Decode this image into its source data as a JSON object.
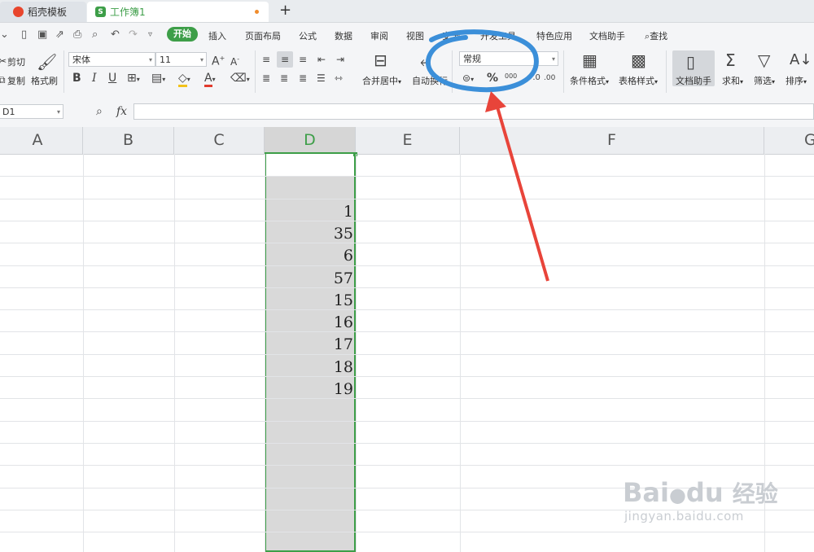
{
  "tabs": [
    {
      "label": "稻壳模板",
      "icon": "docer-logo-icon"
    },
    {
      "label": "工作簿1",
      "icon": "sheet-logo-icon",
      "icon_text": "S"
    }
  ],
  "new_tab_label": "+",
  "menu": {
    "start": "开始",
    "items": [
      "插入",
      "页面布局",
      "公式",
      "数据",
      "审阅",
      "视图",
      "安全",
      "开发工具",
      "特色应用",
      "文档助手"
    ],
    "search": "查找"
  },
  "ribbon": {
    "cut": "剪切",
    "copy": "复制",
    "format_painter": "格式刷",
    "font_name": "宋体",
    "font_size": "11",
    "bold": "B",
    "italic": "I",
    "underline": "U",
    "merge_center": "合并居中",
    "wrap_text": "自动换行",
    "number_format": "常规",
    "percent": "%",
    "thousands": "000",
    "decimal_dec": ".00",
    "conditional_format": "条件格式",
    "table_style": "表格样式",
    "doc_assistant": "文档助手",
    "sum": "求和",
    "filter": "筛选",
    "sort": "排序"
  },
  "formula_bar": {
    "name_box": "D1",
    "fx": "fx",
    "value": ""
  },
  "columns": [
    "A",
    "B",
    "C",
    "D",
    "E",
    "F",
    "G"
  ],
  "selected_column": "D",
  "column_d_values": [
    "1",
    "35",
    "6",
    "57",
    "15",
    "16",
    "17",
    "18",
    "19"
  ],
  "watermark": {
    "line1": "Bai",
    "mid": "du",
    "cn": "经验",
    "url": "jingyan.baidu.com"
  },
  "colors": {
    "accent_green": "#3d9e48",
    "selection_fill": "#d9d9d9",
    "annotation_blue": "#3b8fd9",
    "arrow_red": "#e8443a"
  }
}
